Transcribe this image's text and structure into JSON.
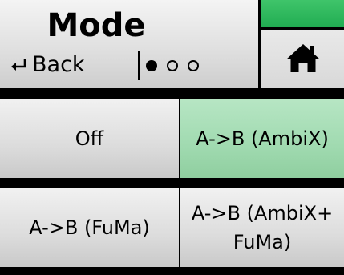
{
  "header": {
    "title": "Mode",
    "back_label": "Back",
    "back_icon": "return-arrow-icon",
    "home_icon": "home-icon",
    "page_indicator": {
      "total": 3,
      "current": 1
    },
    "status_color": "#2bb85c"
  },
  "options": [
    {
      "id": "off",
      "label": "Off",
      "selected": false
    },
    {
      "id": "ambix",
      "label": "A->B (AmbiX)",
      "selected": true
    },
    {
      "id": "fuma",
      "label": "A->B (FuMa)",
      "selected": false
    },
    {
      "id": "ambix_fuma",
      "label_line1": "A->B (AmbiX+",
      "label_line2": "FuMa)",
      "selected": false
    }
  ],
  "colors": {
    "selected": "#a0dab0",
    "unselected": "#dcdcdc",
    "background": "#000000"
  }
}
